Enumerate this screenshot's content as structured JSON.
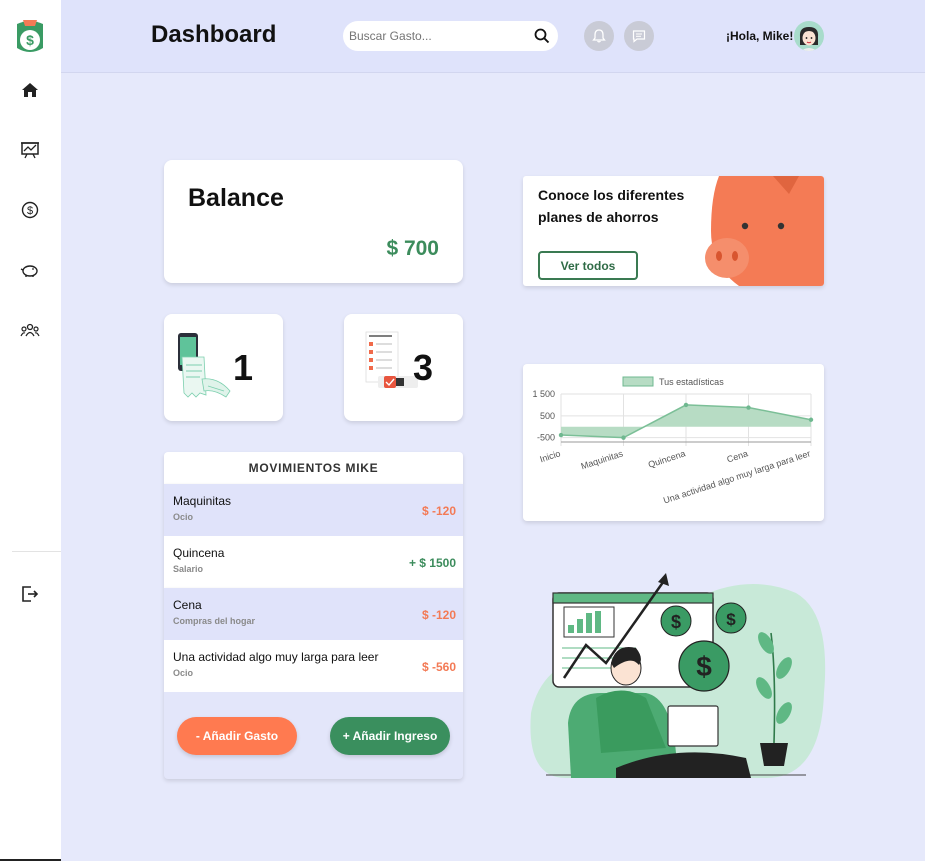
{
  "header": {
    "title": "Dashboard",
    "search_placeholder": "Buscar Gasto...",
    "greeting": "¡Hola, Mike!"
  },
  "sidebar": {
    "items": [
      {
        "icon": "home-icon"
      },
      {
        "icon": "presentation-chart-icon"
      },
      {
        "icon": "dollar-coin-icon"
      },
      {
        "icon": "piggy-bank-icon"
      },
      {
        "icon": "users-group-icon"
      },
      {
        "icon": "logout-icon"
      }
    ]
  },
  "balance": {
    "title": "Balance",
    "value": "$ 700"
  },
  "counters": [
    {
      "value": "1"
    },
    {
      "value": "3"
    }
  ],
  "movements": {
    "title": "MOVIMIENTOS MIKE",
    "items": [
      {
        "name": "Maquinitas",
        "category": "Ocio",
        "amount": "$ -120",
        "type": "neg"
      },
      {
        "name": "Quincena",
        "category": "Salario",
        "amount": "+ $ 1500",
        "type": "pos"
      },
      {
        "name": "Cena",
        "category": "Compras del hogar",
        "amount": "$ -120",
        "type": "neg"
      },
      {
        "name": "Una actividad algo muy larga para leer",
        "category": "Ocio",
        "amount": "$ -560",
        "type": "neg"
      }
    ],
    "add_expense": "- Añadir Gasto",
    "add_income": "+ Añadir Ingreso"
  },
  "promo": {
    "title": "Conoce los diferentes planes de ahorros",
    "button": "Ver todos"
  },
  "chart_data": {
    "type": "area",
    "legend": "Tus estadísticas",
    "categories": [
      "Inicio",
      "Maquinitas",
      "Quincena",
      "Cena",
      "Una actividad algo muy larga para leer"
    ],
    "series": [
      {
        "name": "Tus estadísticas",
        "values": [
          -380,
          -500,
          1000,
          880,
          320
        ]
      }
    ],
    "ylim": [
      -700,
      1500
    ],
    "yticks": [
      "1 500",
      "500",
      "-500"
    ]
  },
  "colors": {
    "accent_green": "#3a8f5e",
    "accent_orange": "#ff7a50",
    "background": "#e6e9fb"
  }
}
